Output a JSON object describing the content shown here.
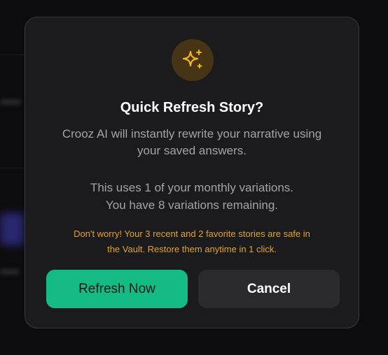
{
  "dialog": {
    "icon": "sparkles-icon",
    "title": "Quick Refresh Story?",
    "description_lines": [
      "Crooz AI will instantly rewrite your narrative using",
      "your saved answers."
    ],
    "usage_lines": [
      "This uses 1 of your monthly variations.",
      "You have 8 variations remaining."
    ],
    "note_lines": [
      "Don't worry! Your 3 recent and 2 favorite stories are safe in",
      "the Vault. Restore them anytime in 1 click."
    ],
    "primary_button": "Refresh Now",
    "secondary_button": "Cancel"
  },
  "colors": {
    "accent_green": "#14bb85",
    "warning_amber": "#e0a32a",
    "icon_gold": "#f2b41f",
    "dialog_bg": "#1b1b1d"
  }
}
